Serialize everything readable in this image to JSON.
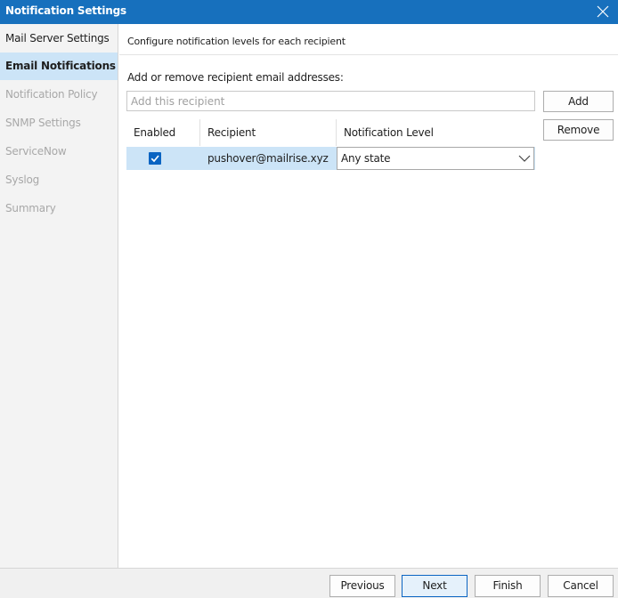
{
  "window": {
    "title": "Notification Settings",
    "close_icon": "close-icon"
  },
  "sidebar": {
    "items": [
      {
        "label": "Mail Server Settings",
        "state": "enabled"
      },
      {
        "label": "Email Notifications",
        "state": "active"
      },
      {
        "label": "Notification Policy",
        "state": "disabled"
      },
      {
        "label": "SNMP Settings",
        "state": "disabled"
      },
      {
        "label": "ServiceNow",
        "state": "disabled"
      },
      {
        "label": "Syslog",
        "state": "disabled"
      },
      {
        "label": "Summary",
        "state": "disabled"
      }
    ]
  },
  "main": {
    "description": "Configure notification levels for each recipient",
    "section_label": "Add or remove recipient email addresses:",
    "recipient_input": {
      "placeholder": "Add this recipient",
      "value": ""
    },
    "add_label": "Add",
    "remove_label": "Remove",
    "table": {
      "columns": [
        "Enabled",
        "Recipient",
        "Notification Level"
      ],
      "rows": [
        {
          "enabled": true,
          "recipient": "pushover@mailrise.xyz",
          "level": "Any state"
        }
      ]
    }
  },
  "footer": {
    "previous_label": "Previous",
    "next_label": "Next",
    "finish_label": "Finish",
    "cancel_label": "Cancel"
  },
  "colors": {
    "titlebar": "#1770bd",
    "selection": "#cce4f7",
    "checkbox": "#0a64c2",
    "disabled_text": "#a8a8a8"
  }
}
